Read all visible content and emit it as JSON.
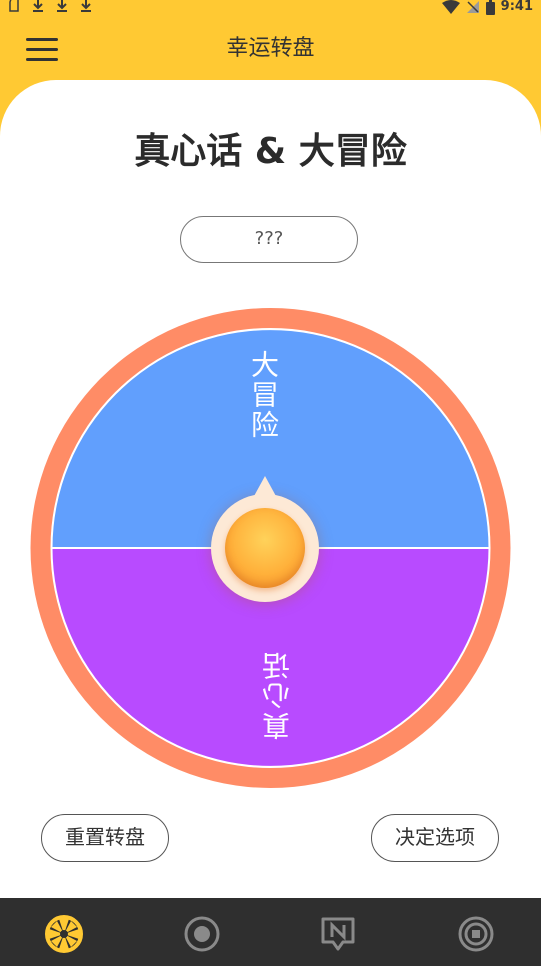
{
  "status_bar": {
    "time": "9:41",
    "icons": [
      "sd-card-icon",
      "download-icon",
      "download-icon",
      "download-icon",
      "wifi-icon",
      "no-signal-icon",
      "battery-icon"
    ]
  },
  "app_bar": {
    "title": "幸运转盘",
    "menu_icon": "hamburger-menu-icon"
  },
  "main": {
    "title": "真心话 & 大冒险",
    "result_text": "???",
    "wheel": {
      "segments": [
        {
          "label": "大冒险",
          "color": "#619ffd"
        },
        {
          "label": "真心话",
          "color": "#b84bff"
        }
      ],
      "rim_color": "#ff8c66"
    },
    "reset_label": "重置转盘",
    "decide_label": "决定选项"
  },
  "bottom_nav": {
    "items": [
      {
        "icon": "wheel-icon",
        "active": true,
        "color": "#ffc933"
      },
      {
        "icon": "record-icon",
        "active": false
      },
      {
        "icon": "notes-icon",
        "active": false
      },
      {
        "icon": "stop-icon",
        "active": false
      }
    ]
  },
  "colors": {
    "accent": "#ffc933",
    "nav_background": "#2f2f2f"
  }
}
